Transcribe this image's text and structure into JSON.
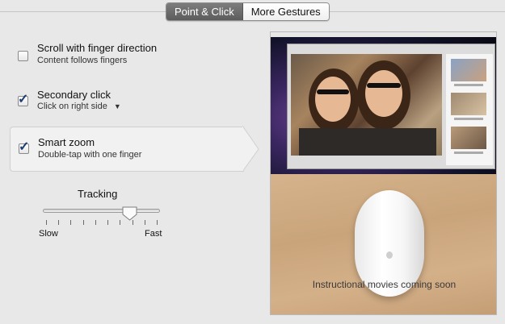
{
  "tabs": [
    {
      "label": "Point & Click",
      "active": true
    },
    {
      "label": "More Gestures",
      "active": false
    }
  ],
  "options": [
    {
      "title": "Scroll with finger direction",
      "subtitle": "Content follows fingers",
      "checked": false
    },
    {
      "title": "Secondary click",
      "subtitle": "Click on right side",
      "checked": true,
      "has_dropdown": true
    },
    {
      "title": "Smart zoom",
      "subtitle": "Double-tap with one finger",
      "checked": true,
      "selected": true
    }
  ],
  "tracking": {
    "label": "Tracking",
    "min_label": "Slow",
    "max_label": "Fast",
    "value_fraction": 0.75,
    "tick_count": 10
  },
  "preview": {
    "caption": "Instructional movies coming soon"
  },
  "icons": {
    "checkmark": "checkmark-icon",
    "dropdown": "chevron-down-icon",
    "apple_logo": "apple-logo-icon"
  },
  "colors": {
    "tab_active_bg": "#6b6b6b",
    "checkmark": "#1d3c72"
  }
}
